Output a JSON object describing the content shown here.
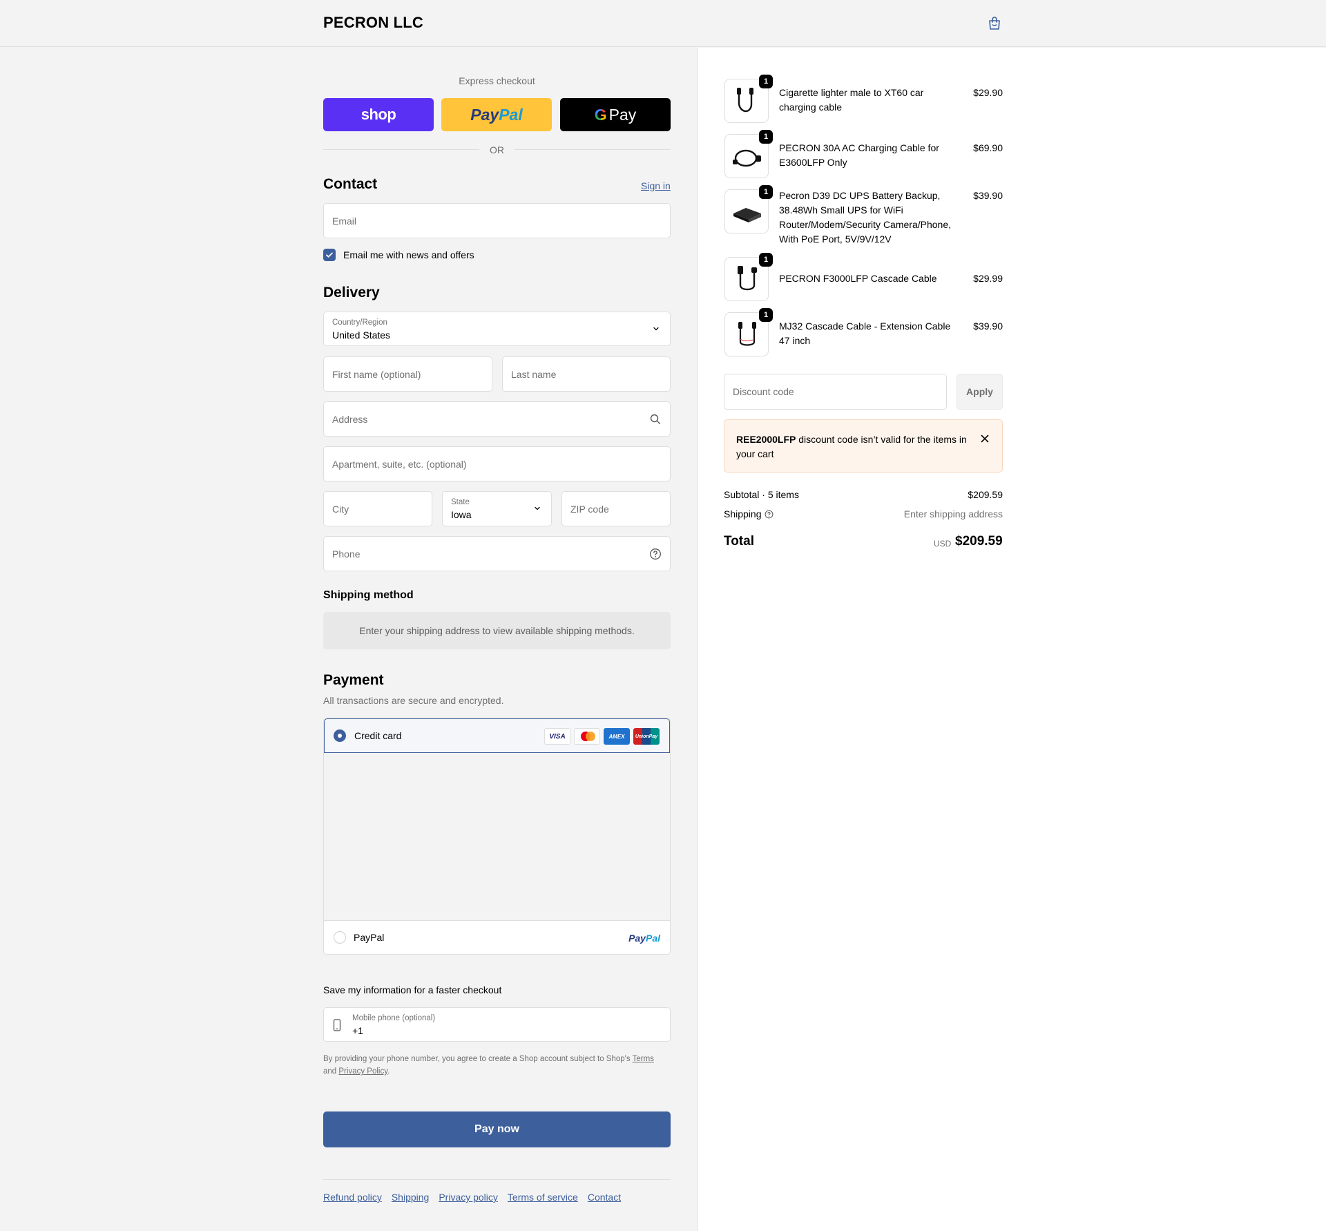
{
  "header": {
    "brand": "PECRON LLC",
    "cart_icon": "shopping-bag-icon"
  },
  "express": {
    "title": "Express checkout",
    "shop_label": "shop",
    "paypal_part1": "Pay",
    "paypal_part2": "Pal",
    "gpay_g": "G",
    "gpay_label": "Pay",
    "or_label": "OR"
  },
  "contact": {
    "heading": "Contact",
    "sign_in": "Sign in",
    "email_placeholder": "Email",
    "newsletter_label": "Email me with news and offers",
    "newsletter_checked": true
  },
  "delivery": {
    "heading": "Delivery",
    "country_label": "Country/Region",
    "country_value": "United States",
    "first_name_placeholder": "First name (optional)",
    "last_name_placeholder": "Last name",
    "address_placeholder": "Address",
    "apartment_placeholder": "Apartment, suite, etc. (optional)",
    "city_placeholder": "City",
    "state_label": "State",
    "state_value": "Iowa",
    "zip_placeholder": "ZIP code",
    "phone_placeholder": "Phone"
  },
  "shipping_method": {
    "heading": "Shipping method",
    "message": "Enter your shipping address to view available shipping methods."
  },
  "payment": {
    "heading": "Payment",
    "subtitle": "All transactions are secure and encrypted.",
    "credit_card_label": "Credit card",
    "cards": [
      "VISA",
      "mastercard",
      "AMEX",
      "UnionPay"
    ],
    "paypal_label": "PayPal",
    "paypal_logo_1": "Pay",
    "paypal_logo_2": "Pal"
  },
  "save_info": {
    "heading": "Save my information for a faster checkout",
    "mobile_label": "Mobile phone (optional)",
    "mobile_value": "+1",
    "legal_prefix": "By providing your phone number, you agree to create a Shop account subject to Shop's",
    "terms": "Terms",
    "and": "and",
    "privacy": "Privacy Policy",
    "period": "."
  },
  "pay_now": "Pay now",
  "footer": {
    "links": [
      "Refund policy",
      "Shipping",
      "Privacy policy",
      "Terms of service",
      "Contact"
    ]
  },
  "cart": {
    "items": [
      {
        "name": "Cigarette lighter male to XT60 car charging cable",
        "price": "$29.90",
        "qty": "1"
      },
      {
        "name": "PECRON 30A AC Charging Cable for E3600LFP Only",
        "price": "$69.90",
        "qty": "1"
      },
      {
        "name": "Pecron D39 DC UPS Battery Backup, 38.48Wh Small UPS for WiFi Router/Modem/Security Camera/Phone, With PoE Port, 5V/9V/12V",
        "price": "$39.90",
        "qty": "1"
      },
      {
        "name": "PECRON F3000LFP Cascade Cable",
        "price": "$29.99",
        "qty": "1"
      },
      {
        "name": "MJ32 Cascade Cable - Extension Cable 47 inch",
        "price": "$39.90",
        "qty": "1"
      }
    ],
    "discount_placeholder": "Discount code",
    "apply_label": "Apply",
    "notice_code": "REE2000LFP",
    "notice_text": " discount code isn’t valid for the items in your cart",
    "subtotal_label": "Subtotal · 5 items",
    "subtotal_value": "$209.59",
    "shipping_label": "Shipping",
    "shipping_value": "Enter shipping address",
    "total_label": "Total",
    "currency": "USD",
    "total_value": "$209.59"
  }
}
